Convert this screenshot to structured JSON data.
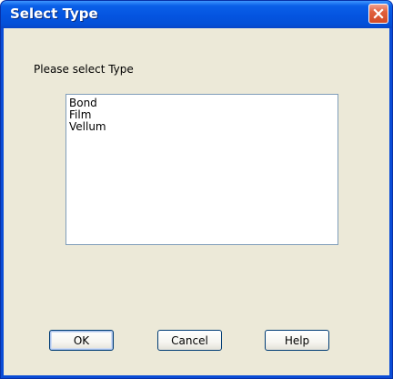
{
  "window": {
    "title": "Select Type",
    "close_icon": "close-icon"
  },
  "dialog": {
    "prompt": "Please select Type",
    "items": [
      {
        "label": "Bond"
      },
      {
        "label": "Film"
      },
      {
        "label": "Vellum"
      }
    ]
  },
  "buttons": {
    "ok": "OK",
    "cancel": "Cancel",
    "help": "Help"
  },
  "colors": {
    "titlebar": "#0454e0",
    "client_bg": "#ece9d8",
    "close_button": "#d24a26",
    "button_border": "#003c74",
    "listbox_border": "#7f9db9"
  }
}
